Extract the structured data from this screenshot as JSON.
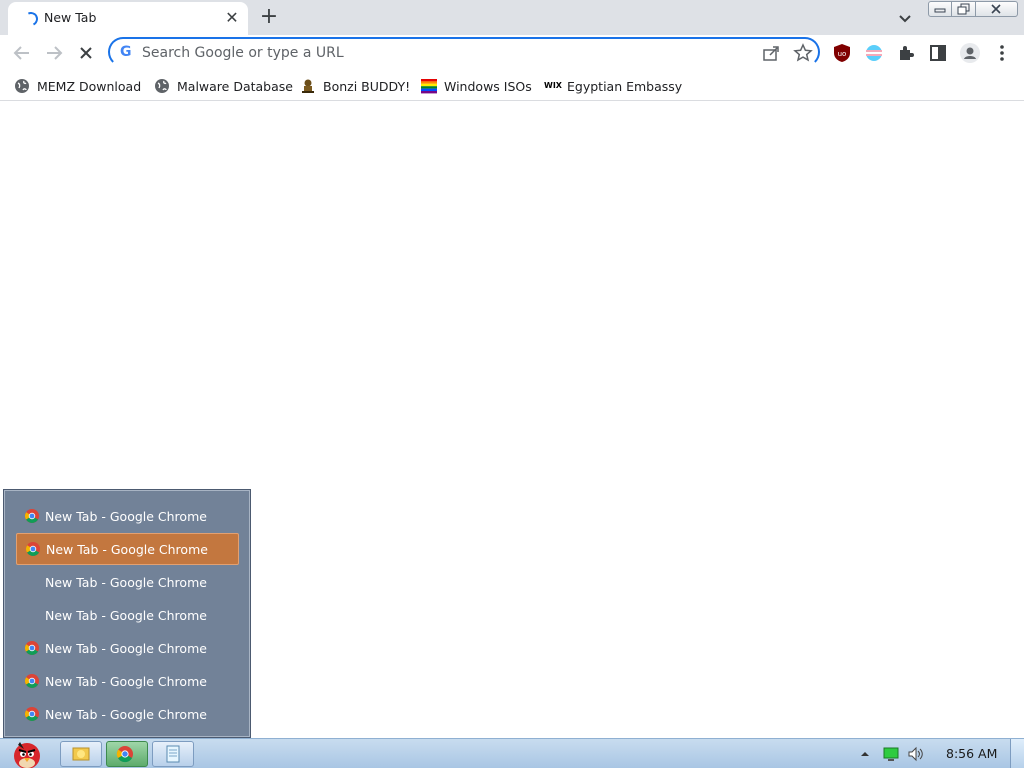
{
  "tab": {
    "title": "New Tab",
    "close": "✕"
  },
  "newtab": "+",
  "omnibox": {
    "placeholder": "Search Google or type a URL"
  },
  "bookmarks": [
    {
      "label": "MEMZ Download",
      "icon": "globe-icon"
    },
    {
      "label": "Malware Database",
      "icon": "globe-icon"
    },
    {
      "label": "Bonzi BUDDY!",
      "icon": "bonzi-icon"
    },
    {
      "label": "Windows ISOs",
      "icon": "rainbow-flag-icon"
    },
    {
      "label": "Egyptian Embassy",
      "icon": "wix-icon",
      "icon_text": "WIX"
    }
  ],
  "jumplist": {
    "items": [
      {
        "label": "New Tab - Google Chrome",
        "icon": "chrome-icon"
      },
      {
        "label": "New Tab - Google Chrome",
        "icon": "chrome-icon",
        "active": true
      },
      {
        "label": "New Tab - Google Chrome",
        "icon": ""
      },
      {
        "label": "New Tab - Google Chrome",
        "icon": ""
      },
      {
        "label": "New Tab - Google Chrome",
        "icon": "chrome-icon"
      },
      {
        "label": "New Tab - Google Chrome",
        "icon": "chrome-icon"
      },
      {
        "label": "New Tab - Google Chrome",
        "icon": "chrome-icon"
      }
    ]
  },
  "taskbar": {
    "clock": "8:56 AM"
  },
  "colors": {
    "accent": "#1a73e8",
    "jumplist_bg": "#728298",
    "jumplist_active": "#c3773f"
  }
}
